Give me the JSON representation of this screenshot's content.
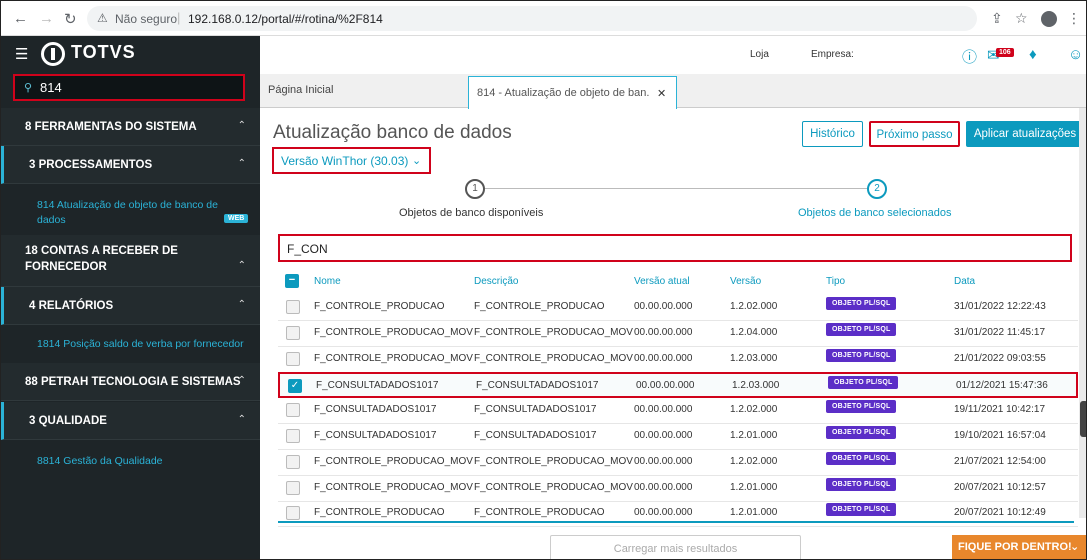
{
  "browser": {
    "not_secure": "Não seguro",
    "url": "192.168.0.12/portal/#/rotina/%2F814"
  },
  "brand": {
    "name": "TOTVS"
  },
  "search": {
    "value": "814"
  },
  "sidebar": {
    "sections": [
      {
        "label": "8  FERRAMENTAS DO SISTEMA"
      },
      {
        "label": "3  PROCESSAMENTOS"
      },
      {
        "label": "18  CONTAS A RECEBER DE"
      },
      {
        "label": "FORNECEDOR"
      },
      {
        "label": "4  RELATÓRIOS"
      },
      {
        "label": "88  PETRAH TECNOLOGIA E SISTEMAS"
      },
      {
        "label": "3  QUALIDADE"
      }
    ],
    "links": [
      {
        "label": "814  Atualização de objeto de banco de"
      },
      {
        "label": "dados"
      },
      {
        "label": "1814  Posição saldo de verba por fornecedor"
      },
      {
        "label": "8814  Gestão da Qualidade"
      }
    ],
    "web_tag": "WEB"
  },
  "header": {
    "loja": "Loja",
    "empresa": "Empresa:",
    "badge": "106"
  },
  "tabs": [
    {
      "label": "Página Inicial"
    },
    {
      "label": "814 - Atualização de objeto de ban..."
    }
  ],
  "page": {
    "title": "Atualização banco de dados",
    "version": "Versão WinThor (30.03)",
    "btn_historico": "Histórico",
    "btn_proximo": "Próximo passo",
    "btn_aplicar": "Aplicar atualizações",
    "step1_num": "1",
    "step1_label": "Objetos de banco disponíveis",
    "step2_num": "2",
    "step2_label": "Objetos de banco selecionados",
    "filter": "F_CON",
    "load_more": "Carregar mais resultados",
    "fique": "FIQUE POR DENTRO!"
  },
  "table": {
    "headers": {
      "nome": "Nome",
      "descricao": "Descrição",
      "versao_atual": "Versão atual",
      "versao": "Versão",
      "tipo": "Tipo",
      "data": "Data"
    },
    "rows": [
      {
        "nome": "F_CONTROLE_PRODUCAO",
        "descricao": "F_CONTROLE_PRODUCAO",
        "versao_atual": "00.00.00.000",
        "versao": "1.2.02.000",
        "tipo": "OBJETO PL/SQL",
        "data": "31/01/2022 12:22:43",
        "checked": false
      },
      {
        "nome": "F_CONTROLE_PRODUCAO_MOV",
        "descricao": "F_CONTROLE_PRODUCAO_MOV",
        "versao_atual": "00.00.00.000",
        "versao": "1.2.04.000",
        "tipo": "OBJETO PL/SQL",
        "data": "31/01/2022 11:45:17",
        "checked": false
      },
      {
        "nome": "F_CONTROLE_PRODUCAO_MOV",
        "descricao": "F_CONTROLE_PRODUCAO_MOV",
        "versao_atual": "00.00.00.000",
        "versao": "1.2.03.000",
        "tipo": "OBJETO PL/SQL",
        "data": "21/01/2022 09:03:55",
        "checked": false
      },
      {
        "nome": "F_CONSULTADADOS1017",
        "descricao": "F_CONSULTADADOS1017",
        "versao_atual": "00.00.00.000",
        "versao": "1.2.03.000",
        "tipo": "OBJETO PL/SQL",
        "data": "01/12/2021 15:47:36",
        "checked": true
      },
      {
        "nome": "F_CONSULTADADOS1017",
        "descricao": "F_CONSULTADADOS1017",
        "versao_atual": "00.00.00.000",
        "versao": "1.2.02.000",
        "tipo": "OBJETO PL/SQL",
        "data": "19/11/2021 10:42:17",
        "checked": false
      },
      {
        "nome": "F_CONSULTADADOS1017",
        "descricao": "F_CONSULTADADOS1017",
        "versao_atual": "00.00.00.000",
        "versao": "1.2.01.000",
        "tipo": "OBJETO PL/SQL",
        "data": "19/10/2021 16:57:04",
        "checked": false
      },
      {
        "nome": "F_CONTROLE_PRODUCAO_MOV",
        "descricao": "F_CONTROLE_PRODUCAO_MOV",
        "versao_atual": "00.00.00.000",
        "versao": "1.2.02.000",
        "tipo": "OBJETO PL/SQL",
        "data": "21/07/2021 12:54:00",
        "checked": false
      },
      {
        "nome": "F_CONTROLE_PRODUCAO_MOV",
        "descricao": "F_CONTROLE_PRODUCAO_MOV",
        "versao_atual": "00.00.00.000",
        "versao": "1.2.01.000",
        "tipo": "OBJETO PL/SQL",
        "data": "20/07/2021 10:12:57",
        "checked": false
      },
      {
        "nome": "F_CONTROLE_PRODUCAO",
        "descricao": "F_CONTROLE_PRODUCAO",
        "versao_atual": "00.00.00.000",
        "versao": "1.2.01.000",
        "tipo": "OBJETO PL/SQL",
        "data": "20/07/2021 10:12:49",
        "checked": false
      }
    ]
  },
  "colors": {
    "accent": "#0c9abe",
    "highlight": "#d0021b",
    "tipo": "#5b2ec7",
    "sidebar": "#1e2528"
  }
}
